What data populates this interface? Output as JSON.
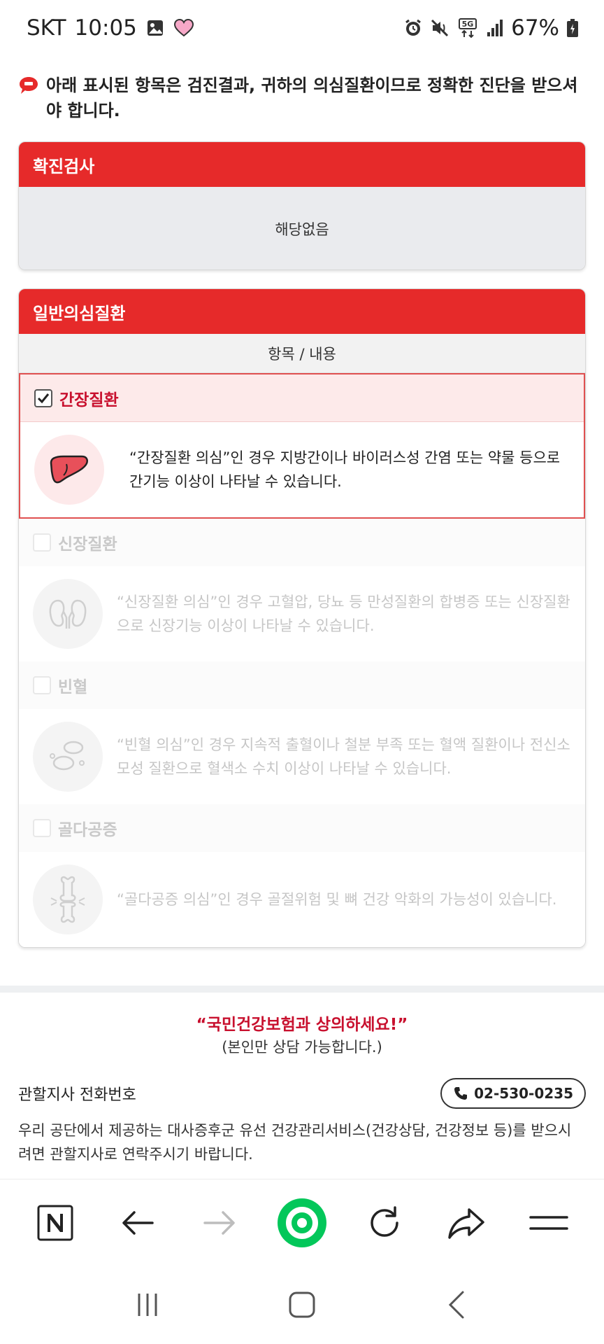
{
  "status_bar": {
    "carrier": "SKT",
    "time": "10:05",
    "network": "5G",
    "battery": "67%"
  },
  "notice": {
    "text": "아래 표시된 항목은 검진결과, 귀하의 의심질환이므로 정확한 진단을 받으셔야 합니다."
  },
  "confirm_card": {
    "title": "확진검사",
    "body": "해당없음"
  },
  "disease_card": {
    "title": "일반의심질환",
    "column_header": "항목 / 내용",
    "items": [
      {
        "title": "간장질환",
        "checked": true,
        "description": "“간장질환 의심”인 경우 지방간이나 바이러스성 간염 또는 약물 등으로 간기능 이상이 나타날 수 있습니다.",
        "icon": "liver-icon"
      },
      {
        "title": "신장질환",
        "checked": false,
        "description": "“신장질환 의심”인 경우 고혈압, 당뇨 등 만성질환의 합병증 또는 신장질환으로 신장기능 이상이 나타날 수 있습니다.",
        "icon": "kidney-icon"
      },
      {
        "title": "빈혈",
        "checked": false,
        "description": "“빈혈 의심”인 경우 지속적 출혈이나 철분 부족 또는 혈액 질환이나 전신소모성 질환으로 혈색소 수치 이상이 나타날 수 있습니다.",
        "icon": "blood-cell-icon"
      },
      {
        "title": "골다공증",
        "checked": false,
        "description": "“골다공증 의심”인 경우 골절위험 및 뼈 건강 악화의 가능성이 있습니다.",
        "icon": "bone-icon"
      }
    ]
  },
  "consult": {
    "title": "“국민건강보험과 상의하세요!”",
    "subtitle": "(본인만 상담 가능합니다.)",
    "branch_label": "관할지사 전화번호",
    "phone": "02-530-0235",
    "service_text": "우리 공단에서 제공하는 대사증후군 유선 건강관리서비스(건강상담, 건강정보 등)를 받으시려면 관할지사로 연락주시기 바랍니다."
  },
  "colors": {
    "primary_red": "#e62a2a",
    "title_red": "#c8102e",
    "naver_green": "#03c75a"
  }
}
